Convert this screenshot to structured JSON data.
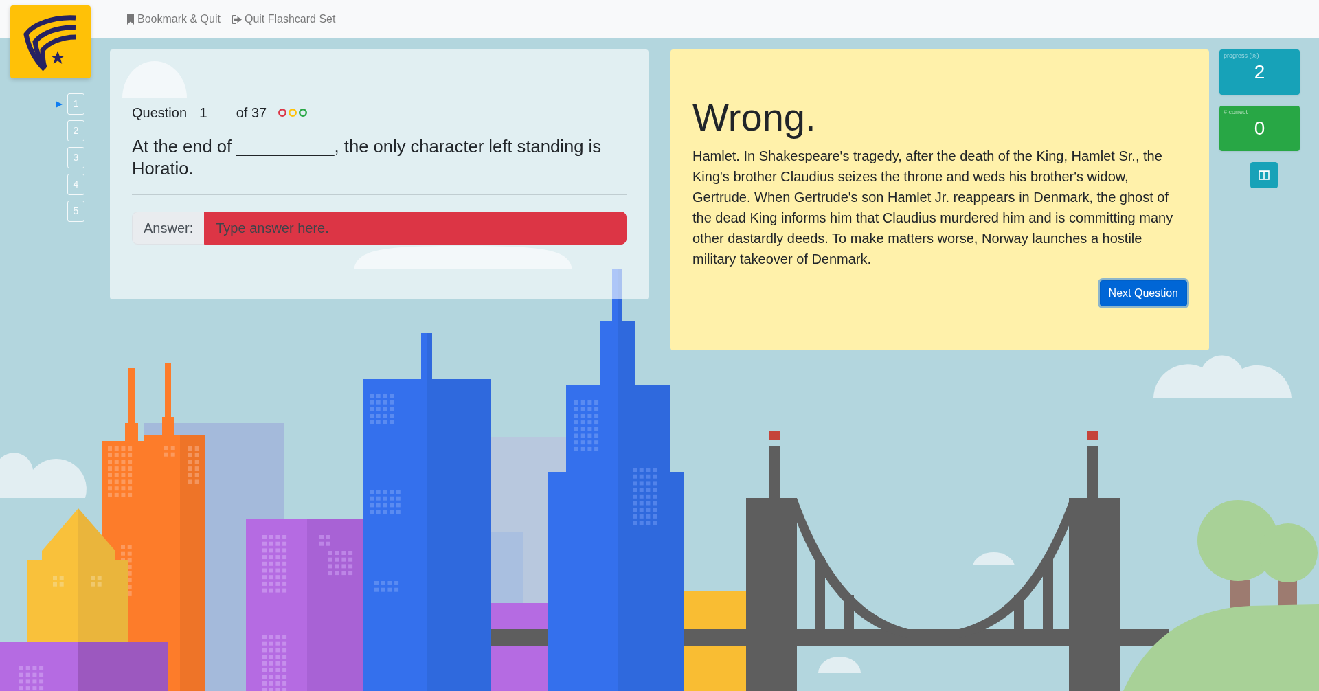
{
  "navbar": {
    "links": [
      "Bookmark & Quit",
      "Quit Flashcard Set"
    ]
  },
  "question_nav": {
    "items": [
      {
        "label": "1",
        "selected": true
      },
      {
        "label": "2",
        "selected": false
      },
      {
        "label": "3",
        "selected": false
      },
      {
        "label": "4",
        "selected": false
      },
      {
        "label": "5",
        "selected": false
      }
    ]
  },
  "question": {
    "label": "Question",
    "number": "1",
    "total": "of 37",
    "status_circles": [
      {
        "color": "#dc3545"
      },
      {
        "color": "#ffc107"
      },
      {
        "color": "#28a745"
      }
    ],
    "text": "At the end of __________, the only character left standing is Horatio.",
    "answer": {
      "label": "Answer:",
      "placeholder": "Type answer here.",
      "correct": false
    }
  },
  "feedback": {
    "title": "Wrong.",
    "explanation": "Hamlet. In Shakespeare's tragedy, after the death of the King, Hamlet Sr., the King's brother Claudius seizes the throne and weds his brother's widow, Gertrude. When Gertrude's son Hamlet Jr. reappears in Denmark, the ghost of the dead King informs him that Claudius murdered him and is committing many other dastardly deeds. To make matters worse, Norway launches a hostile military takeover of Denmark.",
    "button": {
      "label": "Next Question",
      "focused": true
    }
  },
  "stats": [
    {
      "kind": "progress",
      "label": "progress (%)",
      "value": "2"
    },
    {
      "kind": "correct",
      "label": "# correct",
      "value": "0"
    }
  ]
}
